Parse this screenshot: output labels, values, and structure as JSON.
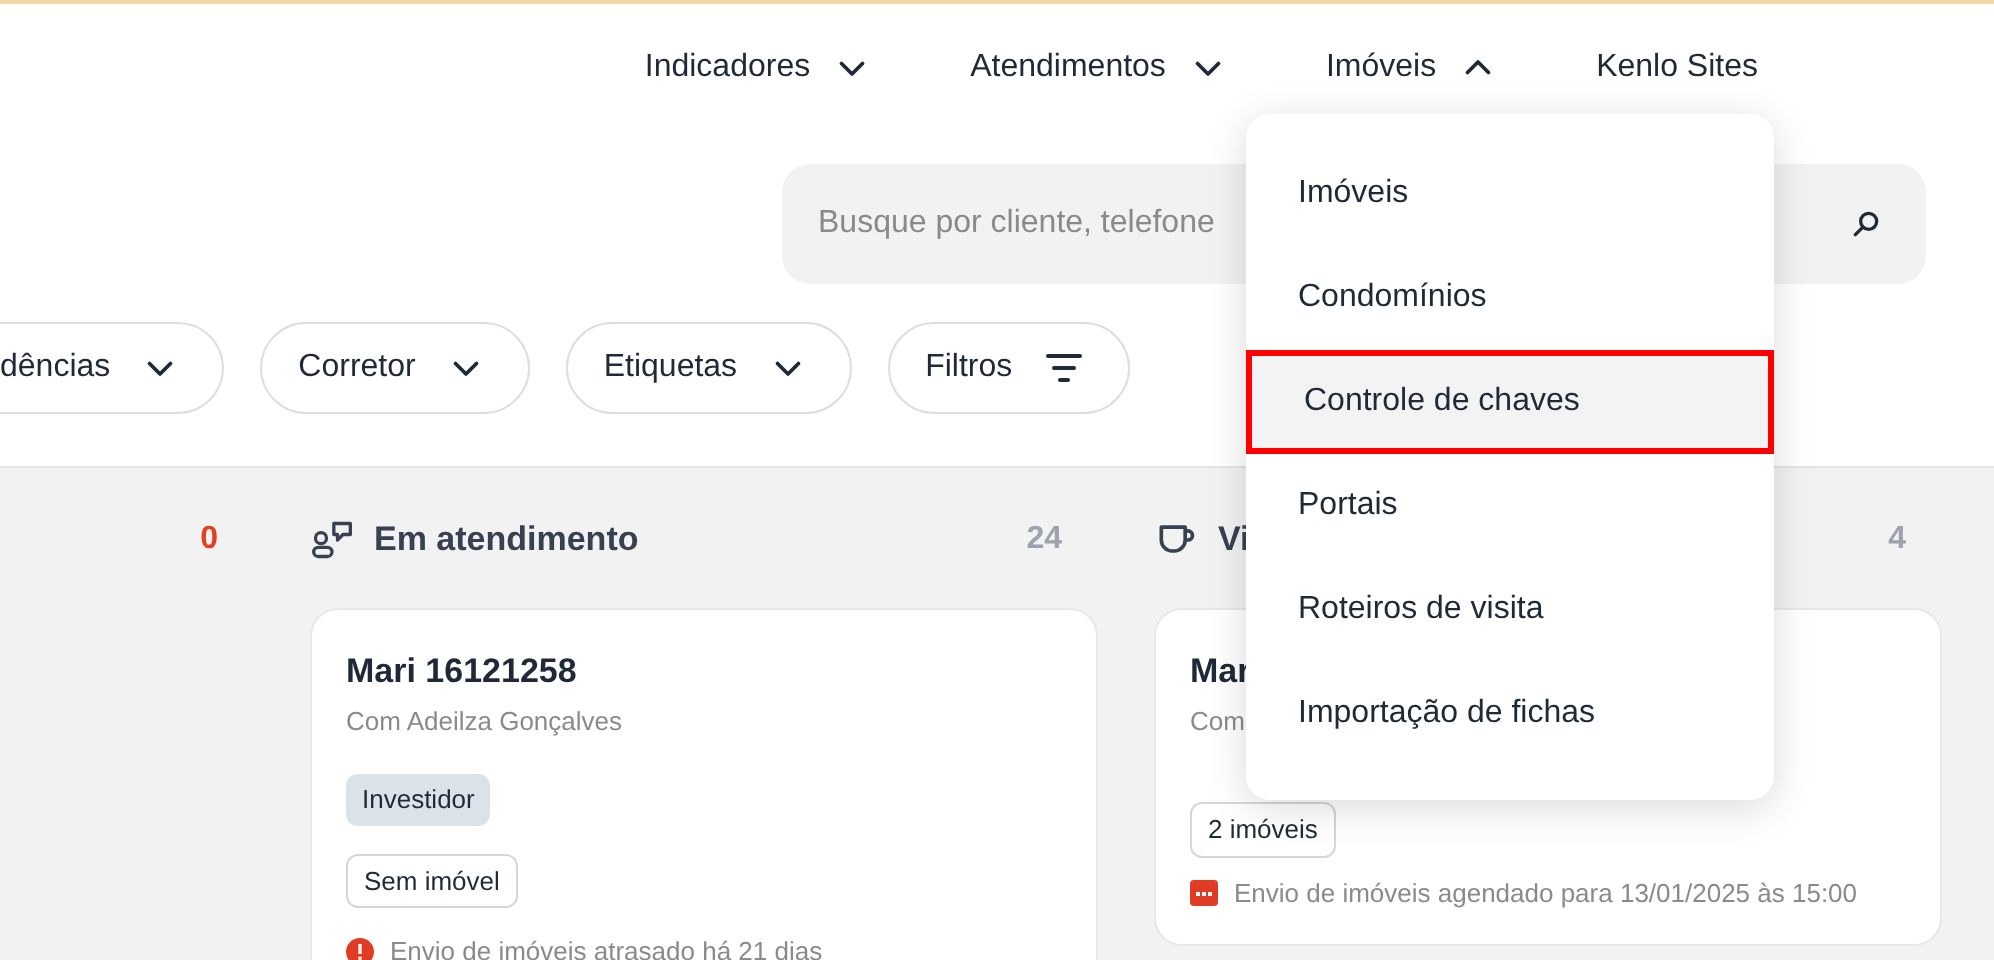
{
  "nav": [
    {
      "label": "Indicadores",
      "kind": "dropdown",
      "expanded": false
    },
    {
      "label": "Atendimentos",
      "kind": "dropdown",
      "expanded": false
    },
    {
      "label": "Imóveis",
      "kind": "dropdown",
      "expanded": true
    },
    {
      "label": "Kenlo Sites",
      "kind": "link"
    }
  ],
  "search": {
    "placeholder": "Busque por cliente, telefone"
  },
  "filters": [
    {
      "label": "dências",
      "kind": "dropdown"
    },
    {
      "label": "Corretor",
      "kind": "dropdown"
    },
    {
      "label": "Etiquetas",
      "kind": "dropdown"
    },
    {
      "label": "Filtros",
      "kind": "filter"
    }
  ],
  "columns": [
    {
      "count": "0",
      "alert": true
    },
    {
      "title": "Em atendimento",
      "count": "24",
      "alert": false,
      "cards": [
        {
          "name": "Mari 16121258",
          "subtitle": "Com Adeilza Gonçalves",
          "tag": "Investidor",
          "property": "Sem imóvel",
          "note": "Envio de imóveis atrasado há 21 dias"
        }
      ]
    },
    {
      "title": "Vi",
      "count": "4",
      "alert": false,
      "cards": [
        {
          "name": "Mar",
          "subtitle": "Com",
          "property": "2 imóveis",
          "note": "Envio de imóveis agendado para 13/01/2025 às 15:00"
        }
      ]
    }
  ],
  "menu": {
    "items": [
      {
        "label": "Imóveis",
        "selected": false
      },
      {
        "label": "Condomínios",
        "selected": false
      },
      {
        "label": "Controle de chaves",
        "selected": true
      },
      {
        "label": "Portais",
        "selected": false
      },
      {
        "label": "Roteiros de visita",
        "selected": false
      },
      {
        "label": "Importação de fichas",
        "selected": false
      }
    ]
  }
}
